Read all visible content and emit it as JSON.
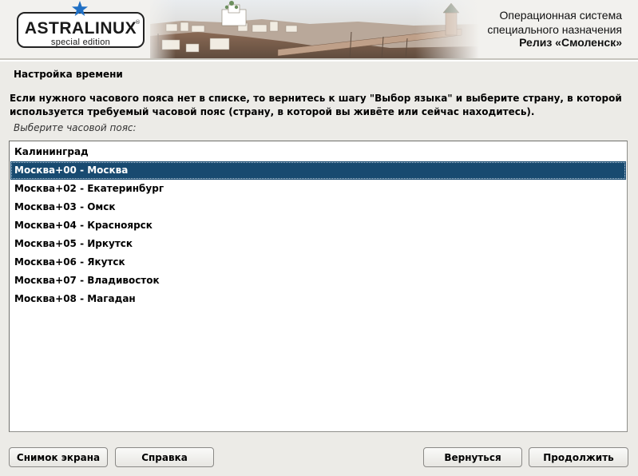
{
  "header": {
    "logo_main": "ASTRALINUX",
    "logo_reg": "®",
    "logo_sub": "special edition",
    "os_title_line1": "Операционная система",
    "os_title_line2": "специального назначения",
    "release": "Релиз «Смоленск»",
    "colors": {
      "star": "#1f6fc4",
      "logo_border": "#222222"
    }
  },
  "page": {
    "section_title": "Настройка времени",
    "help_text": "Если нужного часового пояса нет в списке, то вернитесь к шагу \"Выбор языка\" и выберите страну, в которой используется требуемый часовой пояс (страну, в которой вы живёте или сейчас находитесь).",
    "list_label": "Выберите часовой пояс:"
  },
  "timezones": {
    "selected_index": 1,
    "items": [
      "Калининград",
      "Москва+00 - Москва",
      "Москва+02 - Екатеринбург",
      "Москва+03 - Омск",
      "Москва+04 - Красноярск",
      "Москва+05 - Иркутск",
      "Москва+06 - Якутск",
      "Москва+07 - Владивосток",
      "Москва+08 - Магадан"
    ]
  },
  "buttons": {
    "screenshot": "Снимок экрана",
    "help": "Справка",
    "back": "Вернуться",
    "continue": "Продолжить"
  },
  "colors": {
    "selection": "#184a70",
    "background": "#ecebe7"
  }
}
